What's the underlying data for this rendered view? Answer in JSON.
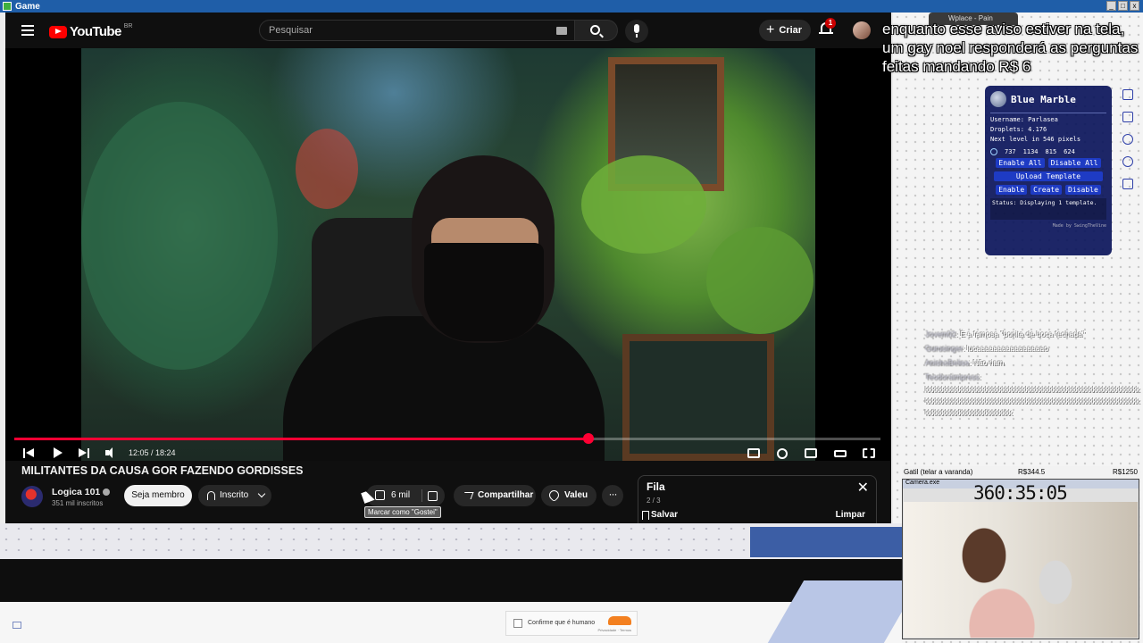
{
  "window": {
    "title": "Game"
  },
  "youtube": {
    "logo_text": "YouTube",
    "region": "BR",
    "search_placeholder": "Pesquisar",
    "create_label": "Criar",
    "notification_count": "1"
  },
  "player": {
    "time": "12:05 / 18:24",
    "progress": 0.663
  },
  "video": {
    "title": "MILITANTES DA CAUSA GOR FAZENDO GORDISSES",
    "channel": "Logica 101",
    "subscribers": "351 mil inscritos",
    "member_label": "Seja membro",
    "subscribed_label": "Inscrito",
    "likes": "6 mil",
    "share_label": "Compartilhar",
    "thanks_label": "Valeu",
    "more_label": "···",
    "like_tooltip": "Marcar como \"Gostei\""
  },
  "queue": {
    "title": "Fila",
    "count": "2 / 3",
    "save_label": "Salvar",
    "clear_label": "Limpar",
    "close_label": "✕"
  },
  "overlay": {
    "caption": "enquanto esse aviso estiver na tela, um gay noel responderá as perguntas feitas mandando R$ 6"
  },
  "wplace_tab": "Wplace - Pain",
  "blue_marble": {
    "title": "Blue Marble",
    "username": "Username: Parlasea",
    "droplets": "Droplets: 4.176",
    "next_level": "Next level in 546 pixels",
    "coords": [
      "737",
      "1134",
      "815",
      "624"
    ],
    "enable_all": "Enable All",
    "disable_all": "Disable All",
    "upload_template": "Upload Template",
    "enable": "Enable",
    "create": "Create",
    "disable": "Disable",
    "status": "Status: Displaying 1 template.",
    "footer": "Made by SwingTheVine"
  },
  "chat": {
    "messages": [
      {
        "user": "Jovem02",
        "text": ": É a famosa \"bonita de boca fechada\""
      },
      {
        "user": "Gurusinger",
        "text": ": lucaaaaaaaaaaaaaaaao"
      },
      {
        "user": "AnishaBelisa",
        "text": ": Não riam"
      },
      {
        "user": "Teodoraimpress",
        "text": ":"
      }
    ],
    "spam": "kkkkkkkkkkkkkkkkkkkkkkkkkkkkkkkkkkkkkkkkkkkkkkkkkkkkkkkkkkkkkkkkkkkkkkkkkkkkkkkkkkkkkkkkkkkkkkkkkkkkkkkkkkkkkkkkkkkkkkkkkkkkkkkkkkkkkkkkkkkkkkkkkkkkkkkkkk"
  },
  "webcam": {
    "goal_label": "Gatil (telar a varanda)",
    "raised": "R$344.5",
    "goal": "R$1250",
    "timer": "360:35:05",
    "window_title": "Camera.exe"
  },
  "cloudflare": {
    "label": "Confirme que é humano",
    "links": "Privacidade · Termos"
  }
}
